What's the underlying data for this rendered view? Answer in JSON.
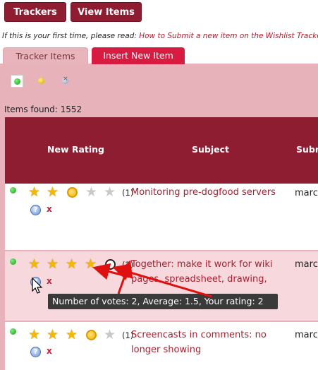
{
  "nav": {
    "trackers_label": "Trackers",
    "view_items_label": "View Items"
  },
  "notice": {
    "text": "If this is your first time, please read: ",
    "link": "How to Submit a new item on the Wishlist Tracker"
  },
  "tabs": {
    "tracker_items": "Tracker Items",
    "insert_new_item": "Insert New Item"
  },
  "filters": [
    "filter-open-icon",
    "filter-pending-icon",
    "filter-closed-icon"
  ],
  "items_found": "Items found: 1552",
  "table": {
    "headers": {
      "rating": "New Rating",
      "subject": "Subject",
      "submitter": "Subm"
    },
    "rows": [
      {
        "count": "(1)",
        "subject": "Monitoring pre-dogfood servers",
        "submitter": "marc",
        "delete": "x"
      },
      {
        "count": "(2)",
        "subject": "Together: make it work for wiki pages, spreadsheet, drawing,",
        "submitter": "marc",
        "delete": "x"
      },
      {
        "count": "(1)",
        "subject": "Screencasts in comments: no longer showing",
        "submitter": "marc",
        "delete": "x"
      }
    ]
  },
  "tooltip": "Number of votes: 2, Average: 1.5, Your rating: 2",
  "colors": {
    "accent": "#8f1d31",
    "tab_active": "#d81b40",
    "panel": "#e8b2bb",
    "row_alt": "#f6d8dd",
    "link": "#a8202f",
    "arrow": "#e01010"
  }
}
